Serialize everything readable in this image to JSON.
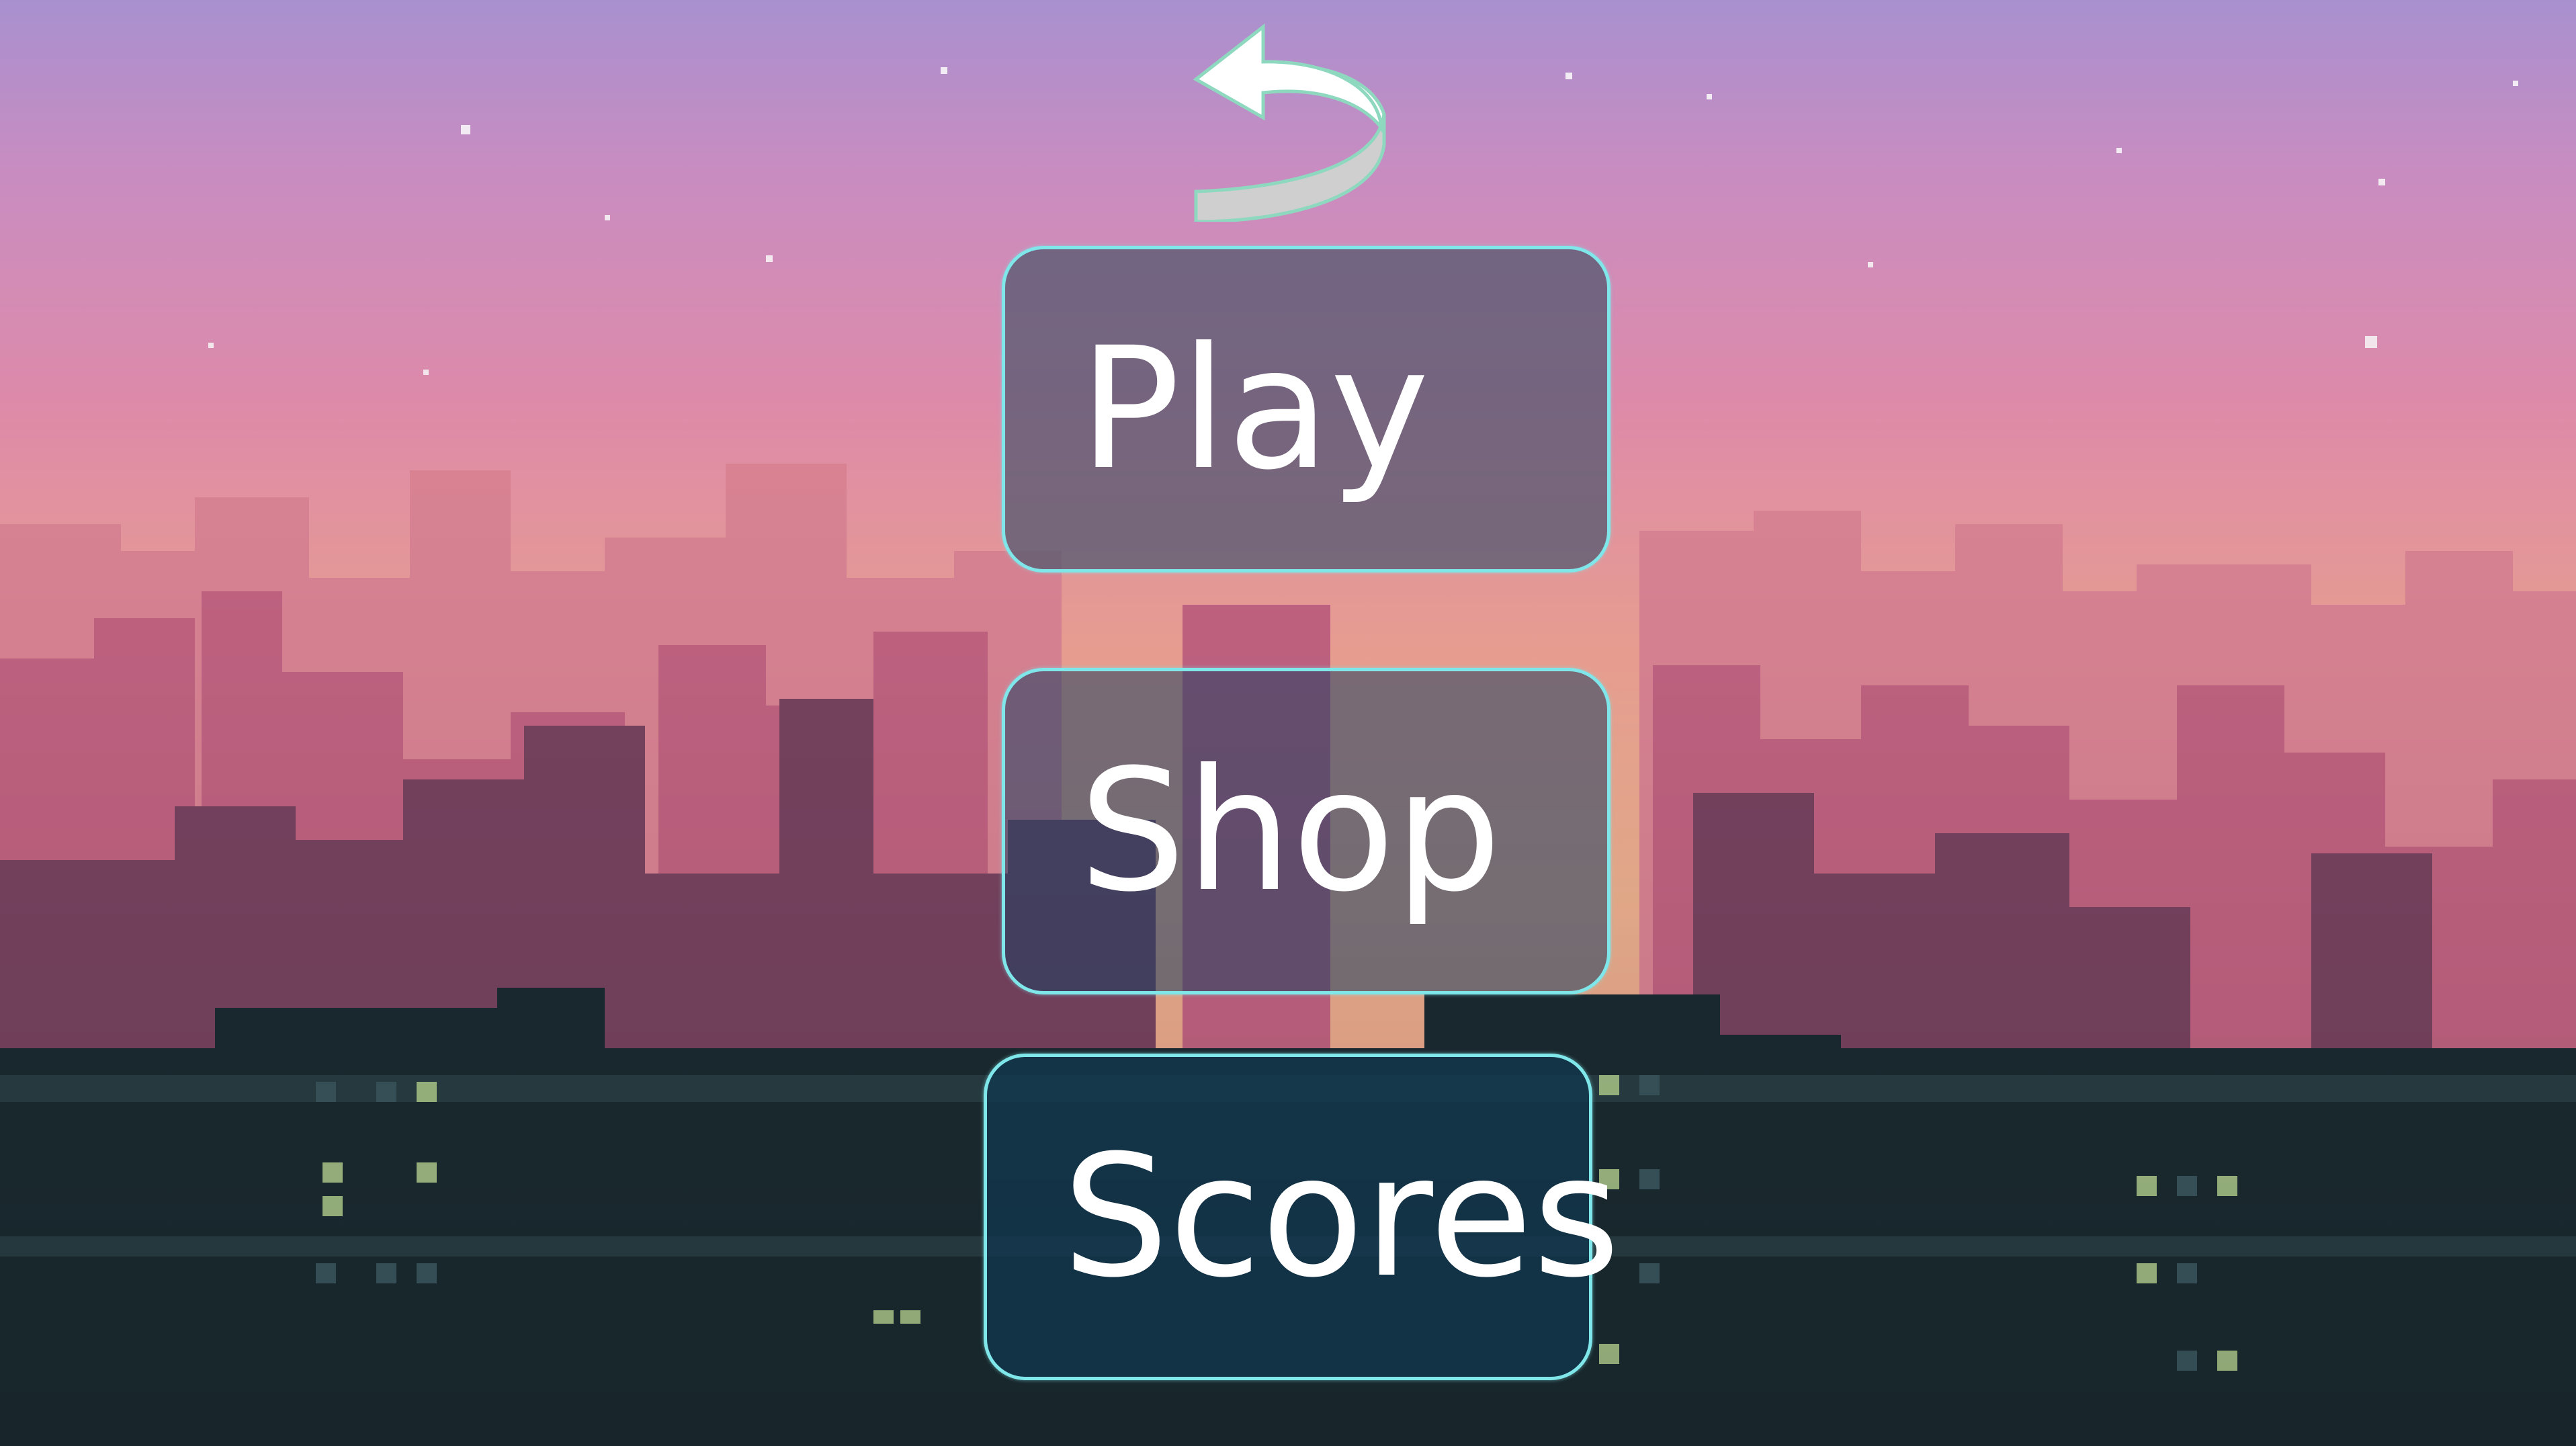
{
  "menu": {
    "play_label": "Play",
    "shop_label": "Shop",
    "scores_label": "Scores"
  },
  "icons": {
    "back": "curved-back-arrow-icon"
  },
  "colors": {
    "button_border": "#7fe6ea",
    "button_text": "#ffffff",
    "sky_top": "#a890cf",
    "sky_mid": "#e790b0",
    "sky_horizon": "#f7b895",
    "foreground": "#1c2d33"
  }
}
